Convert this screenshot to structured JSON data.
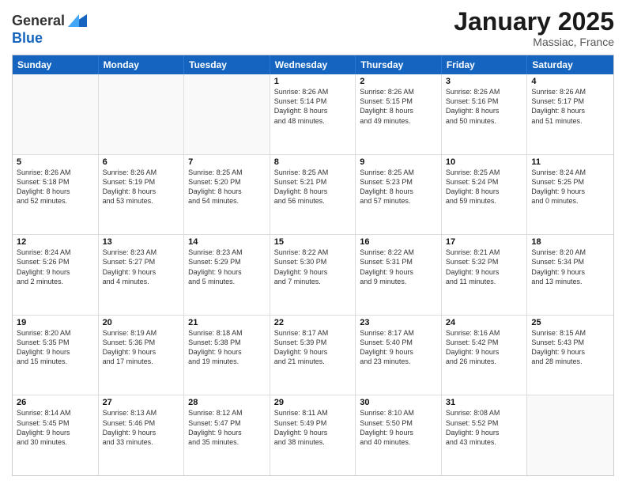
{
  "header": {
    "logo_general": "General",
    "logo_blue": "Blue",
    "month_title": "January 2025",
    "location": "Massiac, France"
  },
  "days_of_week": [
    "Sunday",
    "Monday",
    "Tuesday",
    "Wednesday",
    "Thursday",
    "Friday",
    "Saturday"
  ],
  "weeks": [
    [
      {
        "day": "",
        "info": ""
      },
      {
        "day": "",
        "info": ""
      },
      {
        "day": "",
        "info": ""
      },
      {
        "day": "1",
        "info": "Sunrise: 8:26 AM\nSunset: 5:14 PM\nDaylight: 8 hours\nand 48 minutes."
      },
      {
        "day": "2",
        "info": "Sunrise: 8:26 AM\nSunset: 5:15 PM\nDaylight: 8 hours\nand 49 minutes."
      },
      {
        "day": "3",
        "info": "Sunrise: 8:26 AM\nSunset: 5:16 PM\nDaylight: 8 hours\nand 50 minutes."
      },
      {
        "day": "4",
        "info": "Sunrise: 8:26 AM\nSunset: 5:17 PM\nDaylight: 8 hours\nand 51 minutes."
      }
    ],
    [
      {
        "day": "5",
        "info": "Sunrise: 8:26 AM\nSunset: 5:18 PM\nDaylight: 8 hours\nand 52 minutes."
      },
      {
        "day": "6",
        "info": "Sunrise: 8:26 AM\nSunset: 5:19 PM\nDaylight: 8 hours\nand 53 minutes."
      },
      {
        "day": "7",
        "info": "Sunrise: 8:25 AM\nSunset: 5:20 PM\nDaylight: 8 hours\nand 54 minutes."
      },
      {
        "day": "8",
        "info": "Sunrise: 8:25 AM\nSunset: 5:21 PM\nDaylight: 8 hours\nand 56 minutes."
      },
      {
        "day": "9",
        "info": "Sunrise: 8:25 AM\nSunset: 5:23 PM\nDaylight: 8 hours\nand 57 minutes."
      },
      {
        "day": "10",
        "info": "Sunrise: 8:25 AM\nSunset: 5:24 PM\nDaylight: 8 hours\nand 59 minutes."
      },
      {
        "day": "11",
        "info": "Sunrise: 8:24 AM\nSunset: 5:25 PM\nDaylight: 9 hours\nand 0 minutes."
      }
    ],
    [
      {
        "day": "12",
        "info": "Sunrise: 8:24 AM\nSunset: 5:26 PM\nDaylight: 9 hours\nand 2 minutes."
      },
      {
        "day": "13",
        "info": "Sunrise: 8:23 AM\nSunset: 5:27 PM\nDaylight: 9 hours\nand 4 minutes."
      },
      {
        "day": "14",
        "info": "Sunrise: 8:23 AM\nSunset: 5:29 PM\nDaylight: 9 hours\nand 5 minutes."
      },
      {
        "day": "15",
        "info": "Sunrise: 8:22 AM\nSunset: 5:30 PM\nDaylight: 9 hours\nand 7 minutes."
      },
      {
        "day": "16",
        "info": "Sunrise: 8:22 AM\nSunset: 5:31 PM\nDaylight: 9 hours\nand 9 minutes."
      },
      {
        "day": "17",
        "info": "Sunrise: 8:21 AM\nSunset: 5:32 PM\nDaylight: 9 hours\nand 11 minutes."
      },
      {
        "day": "18",
        "info": "Sunrise: 8:20 AM\nSunset: 5:34 PM\nDaylight: 9 hours\nand 13 minutes."
      }
    ],
    [
      {
        "day": "19",
        "info": "Sunrise: 8:20 AM\nSunset: 5:35 PM\nDaylight: 9 hours\nand 15 minutes."
      },
      {
        "day": "20",
        "info": "Sunrise: 8:19 AM\nSunset: 5:36 PM\nDaylight: 9 hours\nand 17 minutes."
      },
      {
        "day": "21",
        "info": "Sunrise: 8:18 AM\nSunset: 5:38 PM\nDaylight: 9 hours\nand 19 minutes."
      },
      {
        "day": "22",
        "info": "Sunrise: 8:17 AM\nSunset: 5:39 PM\nDaylight: 9 hours\nand 21 minutes."
      },
      {
        "day": "23",
        "info": "Sunrise: 8:17 AM\nSunset: 5:40 PM\nDaylight: 9 hours\nand 23 minutes."
      },
      {
        "day": "24",
        "info": "Sunrise: 8:16 AM\nSunset: 5:42 PM\nDaylight: 9 hours\nand 26 minutes."
      },
      {
        "day": "25",
        "info": "Sunrise: 8:15 AM\nSunset: 5:43 PM\nDaylight: 9 hours\nand 28 minutes."
      }
    ],
    [
      {
        "day": "26",
        "info": "Sunrise: 8:14 AM\nSunset: 5:45 PM\nDaylight: 9 hours\nand 30 minutes."
      },
      {
        "day": "27",
        "info": "Sunrise: 8:13 AM\nSunset: 5:46 PM\nDaylight: 9 hours\nand 33 minutes."
      },
      {
        "day": "28",
        "info": "Sunrise: 8:12 AM\nSunset: 5:47 PM\nDaylight: 9 hours\nand 35 minutes."
      },
      {
        "day": "29",
        "info": "Sunrise: 8:11 AM\nSunset: 5:49 PM\nDaylight: 9 hours\nand 38 minutes."
      },
      {
        "day": "30",
        "info": "Sunrise: 8:10 AM\nSunset: 5:50 PM\nDaylight: 9 hours\nand 40 minutes."
      },
      {
        "day": "31",
        "info": "Sunrise: 8:08 AM\nSunset: 5:52 PM\nDaylight: 9 hours\nand 43 minutes."
      },
      {
        "day": "",
        "info": ""
      }
    ]
  ]
}
